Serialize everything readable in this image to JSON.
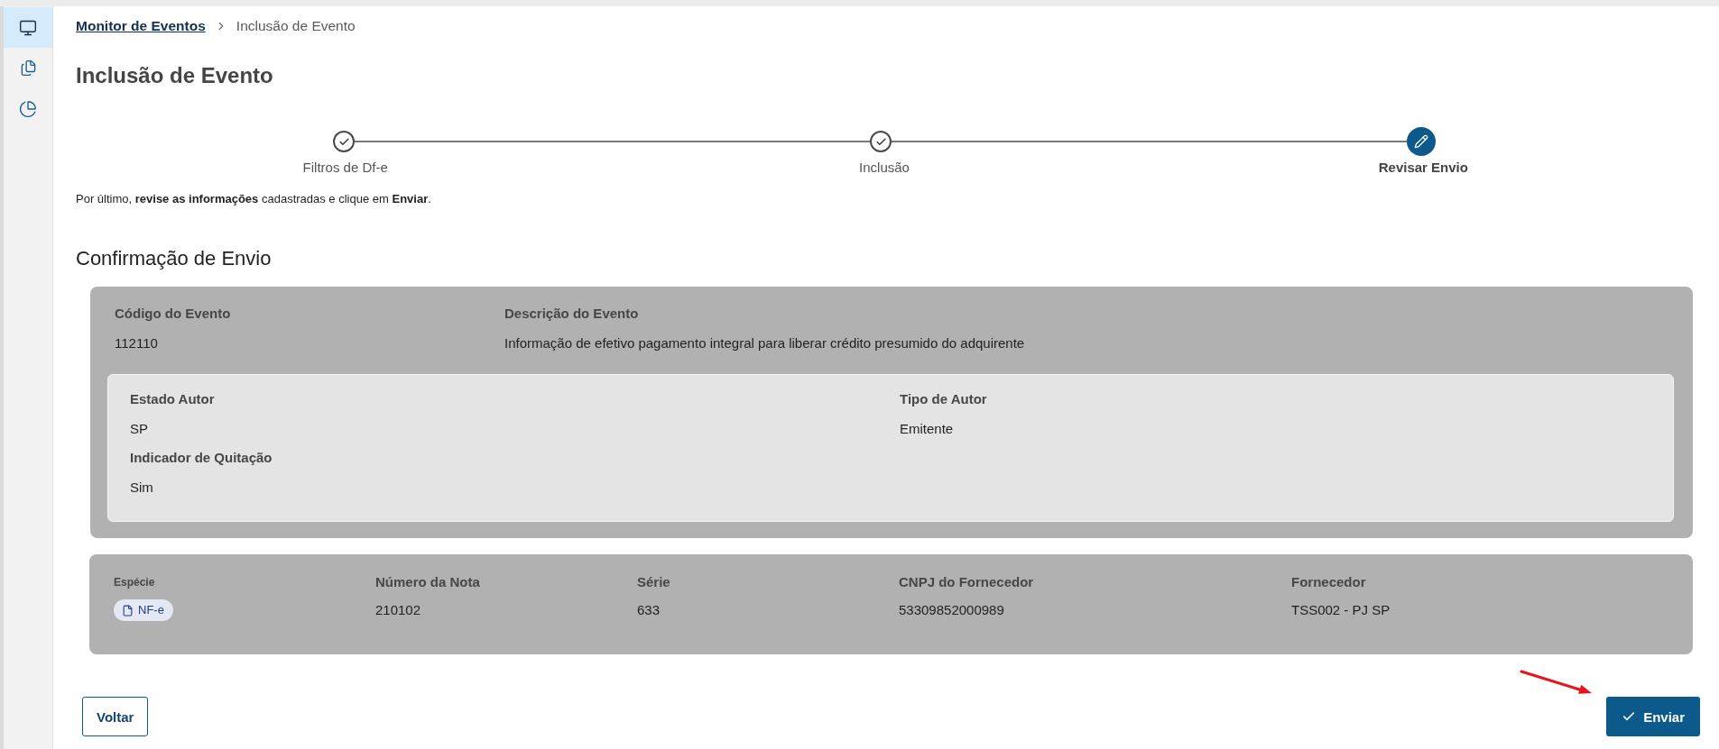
{
  "sidebar": {
    "items": [
      {
        "selected": true
      },
      {
        "selected": false
      },
      {
        "selected": false
      }
    ]
  },
  "breadcrumb": {
    "link": "Monitor de Eventos",
    "current": "Inclusão de Evento"
  },
  "title": "Inclusão de Evento",
  "stepper": {
    "steps": [
      {
        "label": "Filtros de Df-e",
        "completed": true,
        "selected": false
      },
      {
        "label": "Inclusão",
        "completed": true,
        "selected": false
      },
      {
        "label": "Revisar Envio",
        "completed": false,
        "selected": true
      }
    ]
  },
  "instruction": "Por último, **revise as informações** cadastradas e clique em **Enviar**.",
  "section_title": "Confirmação de Envio",
  "event_card": {
    "fields": [
      {
        "label": "Código do Evento",
        "value": "112110"
      },
      {
        "label": "Descrição do Evento",
        "value": "Informação de efetivo pagamento integral para liberar crédito presumido do adquirente"
      }
    ],
    "author_panel": {
      "fields": [
        {
          "label": "Estado Autor",
          "value": "SP"
        },
        {
          "label": "Tipo de Autor",
          "value": "Emitente"
        },
        {
          "label": "Indicador de Quitação",
          "value": "Sim"
        }
      ]
    }
  },
  "invoice_card": {
    "fields": [
      {
        "label": "Espécie",
        "value": "NF-e",
        "kind": "tag"
      },
      {
        "label": "Número da Nota",
        "value": "210102",
        "kind": "text"
      },
      {
        "label": "Série",
        "value": "633",
        "kind": "text"
      },
      {
        "label": "CNPJ do Fornecedor",
        "value": "53309852000989",
        "kind": "text"
      },
      {
        "label": "Fornecedor",
        "value": "TSS002 - PJ SP",
        "kind": "text"
      }
    ]
  },
  "actions": {
    "back": "Voltar",
    "submit": "Enviar"
  }
}
